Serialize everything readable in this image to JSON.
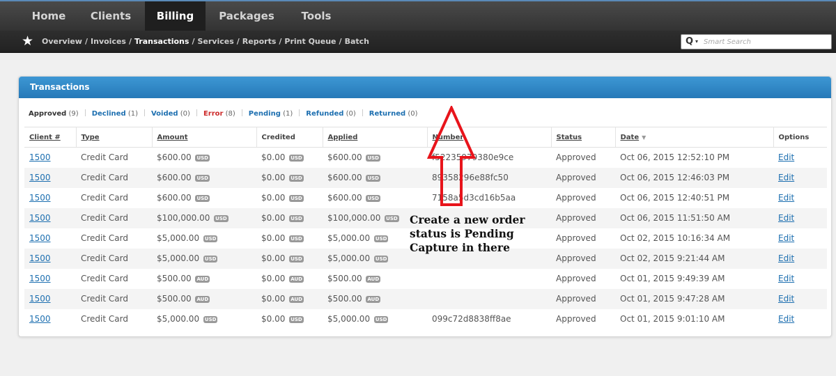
{
  "nav": {
    "tabs": [
      {
        "label": "Home"
      },
      {
        "label": "Clients"
      },
      {
        "label": "Billing"
      },
      {
        "label": "Packages"
      },
      {
        "label": "Tools"
      }
    ],
    "active_tab": "Billing"
  },
  "subnav": {
    "crumbs": [
      "Overview",
      "Invoices",
      "Transactions",
      "Services",
      "Reports",
      "Print Queue",
      "Batch"
    ],
    "current": "Transactions",
    "search_placeholder": "Smart Search"
  },
  "panel": {
    "title": "Transactions",
    "filters": [
      {
        "label": "Approved",
        "count": "(9)"
      },
      {
        "label": "Declined",
        "count": "(1)"
      },
      {
        "label": "Voided",
        "count": "(0)"
      },
      {
        "label": "Error",
        "count": "(8)"
      },
      {
        "label": "Pending",
        "count": "(1)"
      },
      {
        "label": "Refunded",
        "count": "(0)"
      },
      {
        "label": "Returned",
        "count": "(0)"
      }
    ],
    "columns": [
      "Client #",
      "Type",
      "Amount",
      "Credited",
      "Applied",
      "Number",
      "Status",
      "Date",
      "Options"
    ],
    "rows": [
      {
        "client": "1500",
        "type": "Credit Card",
        "amount": "$600.00",
        "amount_cur": "USD",
        "credited": "$0.00",
        "credited_cur": "USD",
        "applied": "$600.00",
        "applied_cur": "USD",
        "number": "f52235979380e9ce",
        "status": "Approved",
        "date": "Oct 06, 2015 12:52:10 PM",
        "option": "Edit"
      },
      {
        "client": "1500",
        "type": "Credit Card",
        "amount": "$600.00",
        "amount_cur": "USD",
        "credited": "$0.00",
        "credited_cur": "USD",
        "applied": "$600.00",
        "applied_cur": "USD",
        "number": "89358296e88fc50",
        "status": "Approved",
        "date": "Oct 06, 2015 12:46:03 PM",
        "option": "Edit"
      },
      {
        "client": "1500",
        "type": "Credit Card",
        "amount": "$600.00",
        "amount_cur": "USD",
        "credited": "$0.00",
        "credited_cur": "USD",
        "applied": "$600.00",
        "applied_cur": "USD",
        "number": "7158a5d3cd16b5aa",
        "status": "Approved",
        "date": "Oct 06, 2015 12:40:51 PM",
        "option": "Edit"
      },
      {
        "client": "1500",
        "type": "Credit Card",
        "amount": "$100,000.00",
        "amount_cur": "USD",
        "credited": "$0.00",
        "credited_cur": "USD",
        "applied": "$100,000.00",
        "applied_cur": "USD",
        "number": "",
        "status": "Approved",
        "date": "Oct 06, 2015 11:51:50 AM",
        "option": "Edit"
      },
      {
        "client": "1500",
        "type": "Credit Card",
        "amount": "$5,000.00",
        "amount_cur": "USD",
        "credited": "$0.00",
        "credited_cur": "USD",
        "applied": "$5,000.00",
        "applied_cur": "USD",
        "number": "",
        "status": "Approved",
        "date": "Oct 02, 2015 10:16:34 AM",
        "option": "Edit"
      },
      {
        "client": "1500",
        "type": "Credit Card",
        "amount": "$5,000.00",
        "amount_cur": "USD",
        "credited": "$0.00",
        "credited_cur": "USD",
        "applied": "$5,000.00",
        "applied_cur": "USD",
        "number": "",
        "status": "Approved",
        "date": "Oct 02, 2015 9:21:44 AM",
        "option": "Edit"
      },
      {
        "client": "1500",
        "type": "Credit Card",
        "amount": "$500.00",
        "amount_cur": "AUD",
        "credited": "$0.00",
        "credited_cur": "AUD",
        "applied": "$500.00",
        "applied_cur": "AUD",
        "number": "",
        "status": "Approved",
        "date": "Oct 01, 2015 9:49:39 AM",
        "option": "Edit"
      },
      {
        "client": "1500",
        "type": "Credit Card",
        "amount": "$500.00",
        "amount_cur": "AUD",
        "credited": "$0.00",
        "credited_cur": "AUD",
        "applied": "$500.00",
        "applied_cur": "AUD",
        "number": "",
        "status": "Approved",
        "date": "Oct 01, 2015 9:47:28 AM",
        "option": "Edit"
      },
      {
        "client": "1500",
        "type": "Credit Card",
        "amount": "$5,000.00",
        "amount_cur": "USD",
        "credited": "$0.00",
        "credited_cur": "USD",
        "applied": "$5,000.00",
        "applied_cur": "USD",
        "number": "099c72d8838ff8ae",
        "status": "Approved",
        "date": "Oct 01, 2015 9:01:10 AM",
        "option": "Edit"
      }
    ]
  },
  "annotation": {
    "lines": [
      "Create a new order",
      "status is Pending",
      "Capture in there"
    ],
    "color": "#e8141b"
  },
  "colors": {
    "accent": "#2b82c4",
    "link": "#1d6fb0",
    "error": "#cc2a2a"
  }
}
